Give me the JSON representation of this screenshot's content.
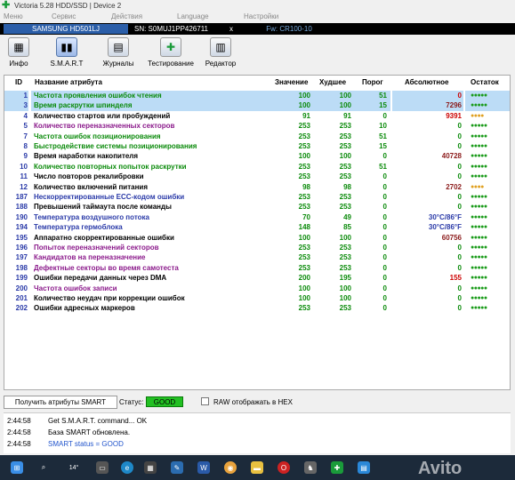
{
  "window": {
    "title": "Victoria 5.28 HDD/SSD | Device 2"
  },
  "menu": [
    "Меню",
    "Сервис",
    "Действия",
    "Language",
    "Настройки"
  ],
  "device": {
    "model": "SAMSUNG HD501LJ",
    "serial": "SN: S0MUJ1PP426711",
    "close": "x",
    "firmware": "Fw: CR100-10"
  },
  "toolbar": [
    {
      "label": "Инфо",
      "icon": "info-icon"
    },
    {
      "label": "S.M.A.R.T",
      "icon": "smart-icon"
    },
    {
      "label": "Журналы",
      "icon": "logs-icon"
    },
    {
      "label": "Тестирование",
      "icon": "testing-icon"
    },
    {
      "label": "Редактор",
      "icon": "editor-icon"
    }
  ],
  "columns": [
    "ID",
    "Название атрибута",
    "Значение",
    "Худшее",
    "Порог",
    "Абсолютное",
    "Остаток"
  ],
  "rows": [
    {
      "id": "1",
      "name": "Частота проявления ошибок чтения",
      "value": "100",
      "worst": "100",
      "thr": "51",
      "abs": "0",
      "rest": "●●●●●",
      "nc": "#0a8a0a",
      "ac": "#cc0000",
      "rc": "#1a9b1a",
      "hl": true
    },
    {
      "id": "3",
      "name": "Время раскрутки шпинделя",
      "value": "100",
      "worst": "100",
      "thr": "15",
      "abs": "7296",
      "rest": "●●●●●",
      "nc": "#0a8a0a",
      "ac": "#8b1a1a",
      "rc": "#1a9b1a",
      "hl": true
    },
    {
      "id": "4",
      "name": "Количество стартов или пробуждений",
      "value": "91",
      "worst": "91",
      "thr": "0",
      "abs": "9391",
      "rest": "●●●●",
      "nc": "#000000",
      "ac": "#cc0000",
      "rc": "#e0a020",
      "hl": false
    },
    {
      "id": "5",
      "name": "Количество переназначенных секторов",
      "value": "253",
      "worst": "253",
      "thr": "10",
      "abs": "0",
      "rest": "●●●●●",
      "nc": "#8b1a8b",
      "ac": "#0a8a0a",
      "rc": "#1a9b1a",
      "hl": false
    },
    {
      "id": "7",
      "name": "Частота ошибок позиционирования",
      "value": "253",
      "worst": "253",
      "thr": "51",
      "abs": "0",
      "rest": "●●●●●",
      "nc": "#0a8a0a",
      "ac": "#0a8a0a",
      "rc": "#1a9b1a",
      "hl": false
    },
    {
      "id": "8",
      "name": "Быстродействие системы позиционирования",
      "value": "253",
      "worst": "253",
      "thr": "15",
      "abs": "0",
      "rest": "●●●●●",
      "nc": "#0a8a0a",
      "ac": "#0a8a0a",
      "rc": "#1a9b1a",
      "hl": false
    },
    {
      "id": "9",
      "name": "Время наработки накопителя",
      "value": "100",
      "worst": "100",
      "thr": "0",
      "abs": "40728",
      "rest": "●●●●●",
      "nc": "#000000",
      "ac": "#8b1a1a",
      "rc": "#1a9b1a",
      "hl": false
    },
    {
      "id": "10",
      "name": "Количество повторных попыток раскрутки",
      "value": "253",
      "worst": "253",
      "thr": "51",
      "abs": "0",
      "rest": "●●●●●",
      "nc": "#0a8a0a",
      "ac": "#0a8a0a",
      "rc": "#1a9b1a",
      "hl": false
    },
    {
      "id": "11",
      "name": "Число повторов рекалибровки",
      "value": "253",
      "worst": "253",
      "thr": "0",
      "abs": "0",
      "rest": "●●●●●",
      "nc": "#000000",
      "ac": "#0a8a0a",
      "rc": "#1a9b1a",
      "hl": false
    },
    {
      "id": "12",
      "name": "Количество включений питания",
      "value": "98",
      "worst": "98",
      "thr": "0",
      "abs": "2702",
      "rest": "●●●●",
      "nc": "#000000",
      "ac": "#8b1a1a",
      "rc": "#e0a020",
      "hl": false
    },
    {
      "id": "187",
      "name": "Нескорректированные ECC-кодом ошибки",
      "value": "253",
      "worst": "253",
      "thr": "0",
      "abs": "0",
      "rest": "●●●●●",
      "nc": "#2a3aa8",
      "ac": "#0a8a0a",
      "rc": "#1a9b1a",
      "hl": false
    },
    {
      "id": "188",
      "name": "Превышений таймаута после команды",
      "value": "253",
      "worst": "253",
      "thr": "0",
      "abs": "0",
      "rest": "●●●●●",
      "nc": "#000000",
      "ac": "#0a8a0a",
      "rc": "#1a9b1a",
      "hl": false
    },
    {
      "id": "190",
      "name": "Температура воздушного потока",
      "value": "70",
      "worst": "49",
      "thr": "0",
      "abs": "30°C/86°F",
      "rest": "●●●●●",
      "nc": "#2a3aa8",
      "ac": "#2a3aa8",
      "rc": "#1a9b1a",
      "hl": false
    },
    {
      "id": "194",
      "name": "Температура гермоблока",
      "value": "148",
      "worst": "85",
      "thr": "0",
      "abs": "30°C/86°F",
      "rest": "●●●●●",
      "nc": "#2a3aa8",
      "ac": "#2a3aa8",
      "rc": "#1a9b1a",
      "hl": false
    },
    {
      "id": "195",
      "name": "Аппаратно скорректированные ошибки",
      "value": "100",
      "worst": "100",
      "thr": "0",
      "abs": "60756",
      "rest": "●●●●●",
      "nc": "#000000",
      "ac": "#8b1a1a",
      "rc": "#1a9b1a",
      "hl": false
    },
    {
      "id": "196",
      "name": "Попыток переназначений секторов",
      "value": "253",
      "worst": "253",
      "thr": "0",
      "abs": "0",
      "rest": "●●●●●",
      "nc": "#8b1a8b",
      "ac": "#0a8a0a",
      "rc": "#1a9b1a",
      "hl": false
    },
    {
      "id": "197",
      "name": "Кандидатов на переназначение",
      "value": "253",
      "worst": "253",
      "thr": "0",
      "abs": "0",
      "rest": "●●●●●",
      "nc": "#8b1a8b",
      "ac": "#0a8a0a",
      "rc": "#1a9b1a",
      "hl": false
    },
    {
      "id": "198",
      "name": "Дефектные секторы во время самотеста",
      "value": "253",
      "worst": "253",
      "thr": "0",
      "abs": "0",
      "rest": "●●●●●",
      "nc": "#8b1a8b",
      "ac": "#0a8a0a",
      "rc": "#1a9b1a",
      "hl": false
    },
    {
      "id": "199",
      "name": "Ошибки передачи данных через DMA",
      "value": "200",
      "worst": "195",
      "thr": "0",
      "abs": "155",
      "rest": "●●●●●",
      "nc": "#000000",
      "ac": "#cc0000",
      "rc": "#1a9b1a",
      "hl": false
    },
    {
      "id": "200",
      "name": "Частота ошибок записи",
      "value": "100",
      "worst": "100",
      "thr": "0",
      "abs": "0",
      "rest": "●●●●●",
      "nc": "#8b1a8b",
      "ac": "#0a8a0a",
      "rc": "#1a9b1a",
      "hl": false
    },
    {
      "id": "201",
      "name": "Количество неудач при коррекции ошибок",
      "value": "100",
      "worst": "100",
      "thr": "0",
      "abs": "0",
      "rest": "●●●●●",
      "nc": "#000000",
      "ac": "#0a8a0a",
      "rc": "#1a9b1a",
      "hl": false
    },
    {
      "id": "202",
      "name": "Ошибки адресных маркеров",
      "value": "253",
      "worst": "253",
      "thr": "0",
      "abs": "0",
      "rest": "●●●●●",
      "nc": "#000000",
      "ac": "#0a8a0a",
      "rc": "#1a9b1a",
      "hl": false
    }
  ],
  "bottom": {
    "get_button": "Получить атрибуты SMART",
    "status_label": "Статус:",
    "status_value": "GOOD",
    "raw_label": "RAW отображать в HEX"
  },
  "log": [
    {
      "time": "2:44:58",
      "msg": "Get S.M.A.R.T. command... OK",
      "color": "#000000"
    },
    {
      "time": "2:44:58",
      "msg": "База SMART обновлена.",
      "color": "#000000"
    },
    {
      "time": "2:44:58",
      "msg": "SMART status = GOOD",
      "color": "#2255cc"
    }
  ],
  "taskbar": {
    "icons": [
      "start-icon",
      "search-icon",
      "weather-icon",
      "taskview-icon",
      "edge-icon",
      "calculator-icon",
      "tools-icon",
      "word-icon",
      "chrome-icon",
      "files-icon",
      "opera-icon",
      "game-icon",
      "victoria-icon",
      "app-icon"
    ],
    "weather_temp": "14°",
    "watermark": "Avito"
  }
}
